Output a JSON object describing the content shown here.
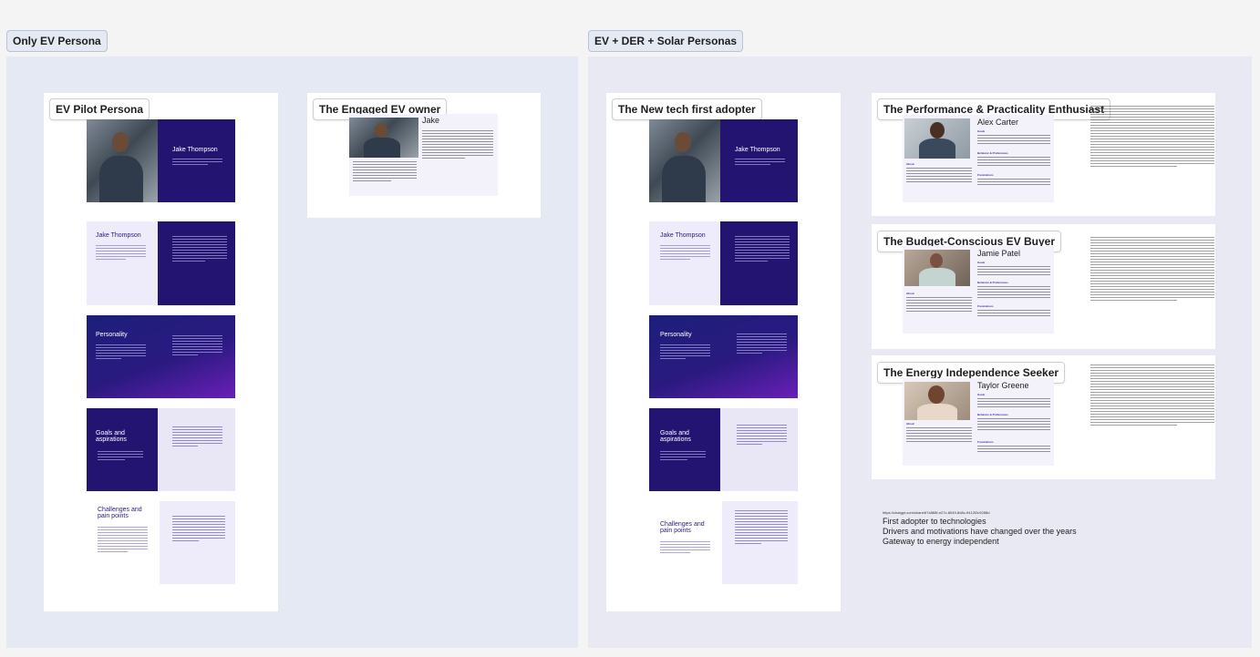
{
  "sections": [
    {
      "label": "Only EV Persona",
      "color": "#e4e9f3"
    },
    {
      "label": "EV + DER + Solar Personas",
      "color": "#e9e9f4"
    }
  ],
  "frames": {
    "ev_pilot": "EV Pilot Persona",
    "engaged": "The Engaged EV owner",
    "new_tech": "The New tech first adopter",
    "performance": "The Performance & Practicality Enthusiast",
    "budget": "The Budget-Conscious EV Buyer",
    "energy": "The Energy Independence Seeker"
  },
  "slides": {
    "name": "Jake Thompson",
    "short_name": "Jake",
    "personality": "Personality",
    "goals": "Goals and aspirations",
    "challenges": "Challenges and pain points"
  },
  "cards": {
    "alex": "Alex Carter",
    "jamie": "Jamie Patel",
    "taylor": "Taylor Greene",
    "about": "About",
    "goals": "Goals",
    "behavior": "Behavior & Preferences",
    "frustrations": "Frustrations"
  },
  "bottom_notes": {
    "url": "https://chatgpt.com/share/67a568f-e27c-8049-8d8c-9412f2c9288d",
    "line1": "First adopter to technologies",
    "line2": "Drivers and motivations have changed over the years",
    "line3": "Gateway to energy independent"
  },
  "colors": {
    "accent_dark": "#241472",
    "lavender": "#eeebfa",
    "purple": "#6a1fb8"
  }
}
